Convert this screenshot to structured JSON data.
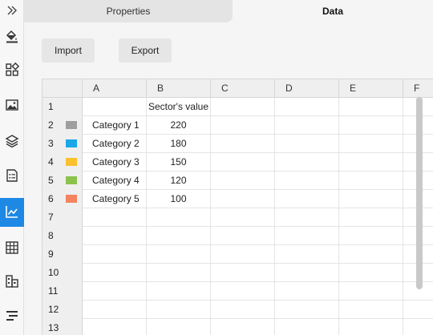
{
  "tabs": {
    "properties": "Properties",
    "data": "Data"
  },
  "toolbar": {
    "import_label": "Import",
    "export_label": "Export"
  },
  "sidebar": {
    "icons": [
      "expand-icon",
      "fill-icon",
      "layout-icon",
      "image-icon",
      "layers-icon",
      "document-icon",
      "chart-icon",
      "table-icon",
      "structure-icon",
      "timeline-icon"
    ],
    "active": "chart-icon",
    "accent": "#1e88e5"
  },
  "sheet": {
    "columns": [
      "A",
      "B",
      "C",
      "D",
      "E",
      "F"
    ],
    "header_b": "Sector's value",
    "rows": [
      {
        "num": "1",
        "a": "",
        "b": "Sector's value",
        "color": ""
      },
      {
        "num": "2",
        "a": "Category 1",
        "b": "220",
        "color": "#9e9e9e"
      },
      {
        "num": "3",
        "a": "Category 2",
        "b": "180",
        "color": "#1aa7e8"
      },
      {
        "num": "4",
        "a": "Category 3",
        "b": "150",
        "color": "#fbc02d"
      },
      {
        "num": "5",
        "a": "Category 4",
        "b": "120",
        "color": "#8bc34a"
      },
      {
        "num": "6",
        "a": "Category 5",
        "b": "100",
        "color": "#f4845f"
      },
      {
        "num": "7",
        "a": "",
        "b": "",
        "color": ""
      },
      {
        "num": "8",
        "a": "",
        "b": "",
        "color": ""
      },
      {
        "num": "9",
        "a": "",
        "b": "",
        "color": ""
      },
      {
        "num": "10",
        "a": "",
        "b": "",
        "color": ""
      },
      {
        "num": "11",
        "a": "",
        "b": "",
        "color": ""
      },
      {
        "num": "12",
        "a": "",
        "b": "",
        "color": ""
      },
      {
        "num": "13",
        "a": "",
        "b": "",
        "color": ""
      }
    ]
  }
}
